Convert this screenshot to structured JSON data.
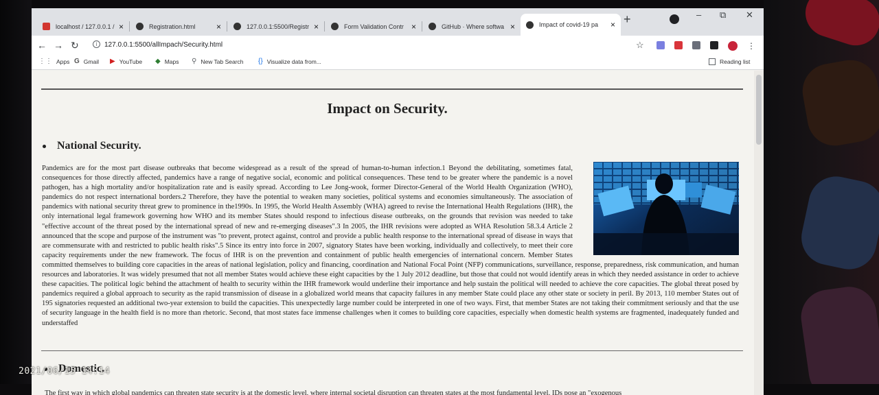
{
  "browser": {
    "tabs": [
      {
        "title": "localhost / 127.0.0.1 /",
        "icon": "phpmyadmin-icon",
        "active": false
      },
      {
        "title": "Registration.html",
        "icon": "globe-icon",
        "active": false
      },
      {
        "title": "127.0.0.1:5500/Registr",
        "icon": "globe-icon",
        "active": false
      },
      {
        "title": "Form Validation Contr",
        "icon": "globe-icon",
        "active": false
      },
      {
        "title": "GitHub · Where softwa",
        "icon": "github-icon",
        "active": false
      },
      {
        "title": "Impact of covid-19 pa",
        "icon": "globe-icon",
        "active": true
      }
    ],
    "tab_close": "×",
    "new_tab": "+",
    "window_controls": {
      "minimize": "–",
      "maximize": "⧉",
      "close": "✕"
    },
    "nav": {
      "back": "←",
      "forward": "→",
      "reload": "↻"
    },
    "url": "127.0.0.1:5500/allImpach/Security.html",
    "bookmarks": [
      {
        "label": "Apps",
        "icon": "apps-grid-icon"
      },
      {
        "label": "Gmail",
        "icon": "gmail-icon"
      },
      {
        "label": "YouTube",
        "icon": "youtube-icon"
      },
      {
        "label": "Maps",
        "icon": "maps-icon"
      },
      {
        "label": "New Tab Search",
        "icon": "search-icon"
      },
      {
        "label": "Visualize data from...",
        "icon": "code-braces-icon"
      }
    ],
    "reading_list": "Reading list"
  },
  "page": {
    "title": "Impact on Security.",
    "section1_heading": "National Security.",
    "section1_text": "Pandemics are for the most part disease outbreaks that become widespread as a result of the spread of human-to-human infection.1 Beyond the debilitating, sometimes fatal, consequences for those directly affected, pandemics have a range of negative social, economic and political consequences. These tend to be greater where the pandemic is a novel pathogen, has a high mortality and/or hospitalization rate and is easily spread. According to Lee Jong-wook, former Director-General of the World Health Organization (WHO), pandemics do not respect international borders.2 Therefore, they have the potential to weaken many societies, political systems and economies simultaneously. The association of pandemics with national security threat grew to prominence in the1990s. In 1995, the World Health Assembly (WHA) agreed to revise the International Health Regulations (IHR), the only international legal framework governing how WHO and its member States should respond to infectious disease outbreaks, on the grounds that revision was needed to take \"effective account of the threat posed by the international spread of new and re-emerging diseases\".3 In 2005, the IHR revisions were adopted as WHA Resolution 58.3.4 Article 2 announced that the scope and purpose of the instrument was \"to prevent, protect against, control and provide a public health response to the international spread of disease in ways that are commensurate with and restricted to public health risks\".5 Since its entry into force in 2007, signatory States have been working, individually and collectively, to meet their core capacity requirements under the new framework. The focus of IHR is on the prevention and containment of public health emergencies of international concern. Member States committed themselves to building core capacities in the areas of national legislation, policy and financing, coordination and National Focal Point (NFP) communications, surveillance, response, preparedness, risk communication, and human resources and laboratories. It was widely presumed that not all member States would achieve these eight capacities by the 1 July 2012 deadline, but those that could not would identify areas in which they needed assistance in order to achieve these capacities. The political logic behind the attachment of health to security within the IHR framework would underline their importance and help sustain the political will needed to achieve the core capacities. The global threat posed by pandemics required a global approach to security as the rapid transmission of disease in a globalized world means that capacity failures in any member State could place any other state or society in peril. By 2013, 110 member States out of 195 signatories requested an additional two-year extension to build the capacities. This unexpectedly large number could be interpreted in one of two ways. First, that member States are not taking their commitment seriously and that the use of security language in the health field is no more than rhetoric. Second, that most states face immense challenges when it comes to building core capacities, especially when domestic health systems are fragmented, inadequately funded and understaffed",
    "section2_heading": "Domestic.",
    "section2_text": "The first way in which global pandemics can threaten state security is at the domestic level, where internal societal disruption can threaten states at the most fundamental level. IDs pose an \"exogenous"
  },
  "photo_timestamp": "2021/06/15 14:14"
}
